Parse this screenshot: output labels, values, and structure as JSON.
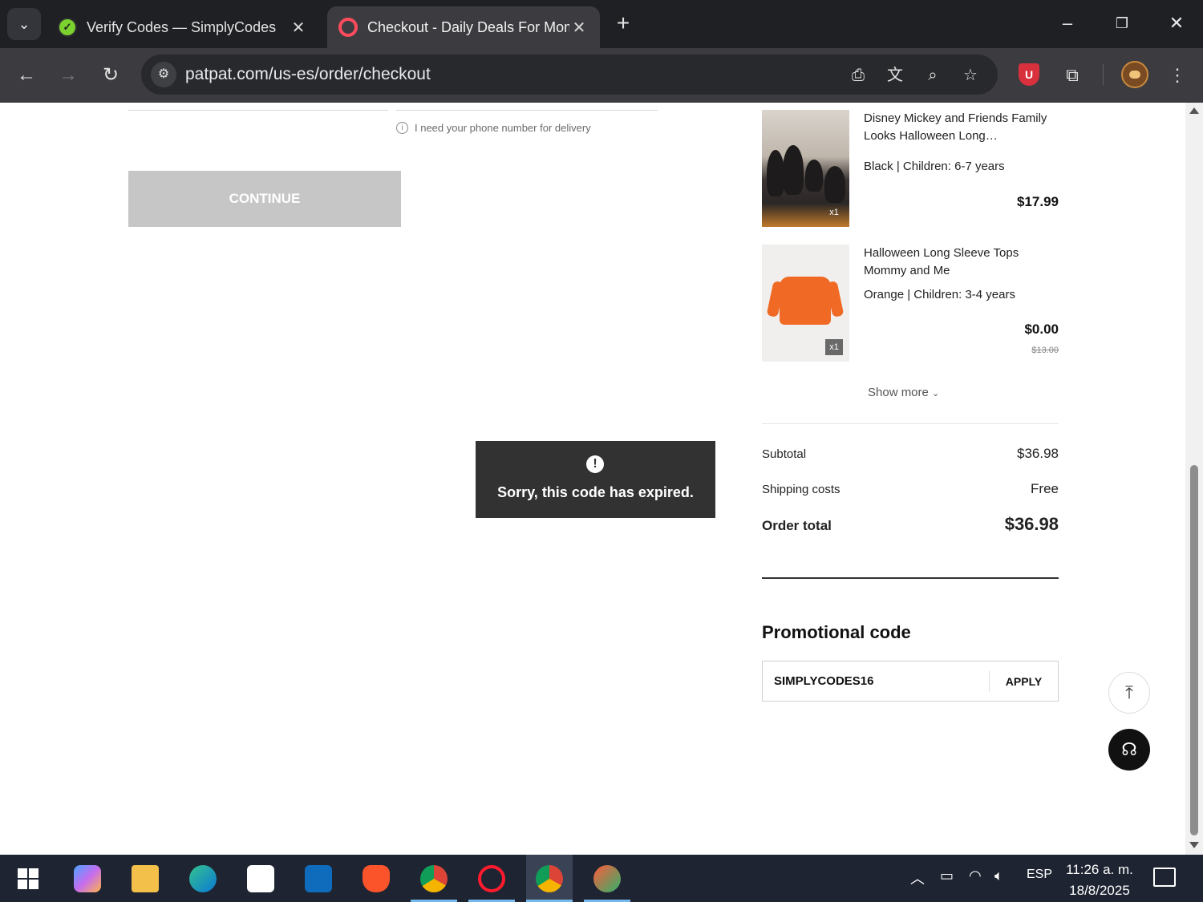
{
  "browser": {
    "tabs": [
      {
        "title": "Verify Codes — SimplyCodes",
        "active": false
      },
      {
        "title": "Checkout - Daily Deals For Moms, Babies and Kids",
        "active": true
      }
    ],
    "url": "patpat.com/us-es/order/checkout"
  },
  "checkout": {
    "phone_hint": "I need your phone number for delivery",
    "continue_label": "CONTINUE"
  },
  "toast": {
    "message": "Sorry, this code has expired."
  },
  "order_items": [
    {
      "name": "Disney Mickey and Friends Family Looks Halloween Long…",
      "variant": "Black | Children: 6-7 years",
      "price": "$17.99",
      "quantity": "x1"
    },
    {
      "name": "Halloween Long Sleeve Tops Mommy and Me",
      "variant": "Orange | Children: 3-4 years",
      "price": "$0.00",
      "original_price": "$13.00",
      "quantity": "x1"
    }
  ],
  "show_more_label": "Show more",
  "summary": {
    "subtotal_label": "Subtotal",
    "subtotal_value": "$36.98",
    "shipping_label": "Shipping costs",
    "shipping_value": "Free",
    "total_label": "Order total",
    "total_value": "$36.98"
  },
  "promo": {
    "title": "Promotional code",
    "code_value": "SIMPLYCODES16",
    "apply_label": "APPLY"
  },
  "taskbar": {
    "language": "ESP",
    "time": "11:26 a. m.",
    "date": "18/8/2025"
  }
}
